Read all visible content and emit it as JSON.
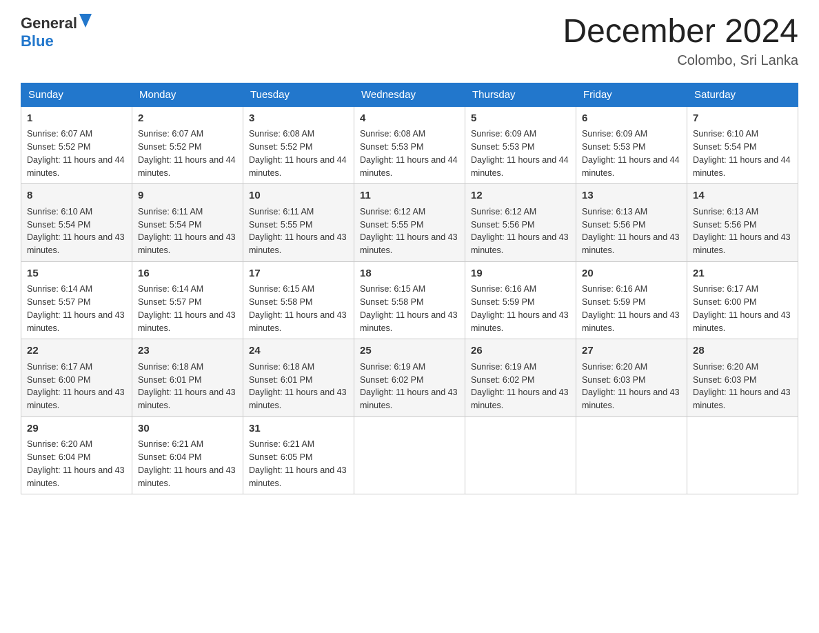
{
  "logo": {
    "text_general": "General",
    "text_blue": "Blue"
  },
  "title": "December 2024",
  "location": "Colombo, Sri Lanka",
  "days_of_week": [
    "Sunday",
    "Monday",
    "Tuesday",
    "Wednesday",
    "Thursday",
    "Friday",
    "Saturday"
  ],
  "weeks": [
    [
      {
        "day": "1",
        "sunrise": "Sunrise: 6:07 AM",
        "sunset": "Sunset: 5:52 PM",
        "daylight": "Daylight: 11 hours and 44 minutes."
      },
      {
        "day": "2",
        "sunrise": "Sunrise: 6:07 AM",
        "sunset": "Sunset: 5:52 PM",
        "daylight": "Daylight: 11 hours and 44 minutes."
      },
      {
        "day": "3",
        "sunrise": "Sunrise: 6:08 AM",
        "sunset": "Sunset: 5:52 PM",
        "daylight": "Daylight: 11 hours and 44 minutes."
      },
      {
        "day": "4",
        "sunrise": "Sunrise: 6:08 AM",
        "sunset": "Sunset: 5:53 PM",
        "daylight": "Daylight: 11 hours and 44 minutes."
      },
      {
        "day": "5",
        "sunrise": "Sunrise: 6:09 AM",
        "sunset": "Sunset: 5:53 PM",
        "daylight": "Daylight: 11 hours and 44 minutes."
      },
      {
        "day": "6",
        "sunrise": "Sunrise: 6:09 AM",
        "sunset": "Sunset: 5:53 PM",
        "daylight": "Daylight: 11 hours and 44 minutes."
      },
      {
        "day": "7",
        "sunrise": "Sunrise: 6:10 AM",
        "sunset": "Sunset: 5:54 PM",
        "daylight": "Daylight: 11 hours and 44 minutes."
      }
    ],
    [
      {
        "day": "8",
        "sunrise": "Sunrise: 6:10 AM",
        "sunset": "Sunset: 5:54 PM",
        "daylight": "Daylight: 11 hours and 43 minutes."
      },
      {
        "day": "9",
        "sunrise": "Sunrise: 6:11 AM",
        "sunset": "Sunset: 5:54 PM",
        "daylight": "Daylight: 11 hours and 43 minutes."
      },
      {
        "day": "10",
        "sunrise": "Sunrise: 6:11 AM",
        "sunset": "Sunset: 5:55 PM",
        "daylight": "Daylight: 11 hours and 43 minutes."
      },
      {
        "day": "11",
        "sunrise": "Sunrise: 6:12 AM",
        "sunset": "Sunset: 5:55 PM",
        "daylight": "Daylight: 11 hours and 43 minutes."
      },
      {
        "day": "12",
        "sunrise": "Sunrise: 6:12 AM",
        "sunset": "Sunset: 5:56 PM",
        "daylight": "Daylight: 11 hours and 43 minutes."
      },
      {
        "day": "13",
        "sunrise": "Sunrise: 6:13 AM",
        "sunset": "Sunset: 5:56 PM",
        "daylight": "Daylight: 11 hours and 43 minutes."
      },
      {
        "day": "14",
        "sunrise": "Sunrise: 6:13 AM",
        "sunset": "Sunset: 5:56 PM",
        "daylight": "Daylight: 11 hours and 43 minutes."
      }
    ],
    [
      {
        "day": "15",
        "sunrise": "Sunrise: 6:14 AM",
        "sunset": "Sunset: 5:57 PM",
        "daylight": "Daylight: 11 hours and 43 minutes."
      },
      {
        "day": "16",
        "sunrise": "Sunrise: 6:14 AM",
        "sunset": "Sunset: 5:57 PM",
        "daylight": "Daylight: 11 hours and 43 minutes."
      },
      {
        "day": "17",
        "sunrise": "Sunrise: 6:15 AM",
        "sunset": "Sunset: 5:58 PM",
        "daylight": "Daylight: 11 hours and 43 minutes."
      },
      {
        "day": "18",
        "sunrise": "Sunrise: 6:15 AM",
        "sunset": "Sunset: 5:58 PM",
        "daylight": "Daylight: 11 hours and 43 minutes."
      },
      {
        "day": "19",
        "sunrise": "Sunrise: 6:16 AM",
        "sunset": "Sunset: 5:59 PM",
        "daylight": "Daylight: 11 hours and 43 minutes."
      },
      {
        "day": "20",
        "sunrise": "Sunrise: 6:16 AM",
        "sunset": "Sunset: 5:59 PM",
        "daylight": "Daylight: 11 hours and 43 minutes."
      },
      {
        "day": "21",
        "sunrise": "Sunrise: 6:17 AM",
        "sunset": "Sunset: 6:00 PM",
        "daylight": "Daylight: 11 hours and 43 minutes."
      }
    ],
    [
      {
        "day": "22",
        "sunrise": "Sunrise: 6:17 AM",
        "sunset": "Sunset: 6:00 PM",
        "daylight": "Daylight: 11 hours and 43 minutes."
      },
      {
        "day": "23",
        "sunrise": "Sunrise: 6:18 AM",
        "sunset": "Sunset: 6:01 PM",
        "daylight": "Daylight: 11 hours and 43 minutes."
      },
      {
        "day": "24",
        "sunrise": "Sunrise: 6:18 AM",
        "sunset": "Sunset: 6:01 PM",
        "daylight": "Daylight: 11 hours and 43 minutes."
      },
      {
        "day": "25",
        "sunrise": "Sunrise: 6:19 AM",
        "sunset": "Sunset: 6:02 PM",
        "daylight": "Daylight: 11 hours and 43 minutes."
      },
      {
        "day": "26",
        "sunrise": "Sunrise: 6:19 AM",
        "sunset": "Sunset: 6:02 PM",
        "daylight": "Daylight: 11 hours and 43 minutes."
      },
      {
        "day": "27",
        "sunrise": "Sunrise: 6:20 AM",
        "sunset": "Sunset: 6:03 PM",
        "daylight": "Daylight: 11 hours and 43 minutes."
      },
      {
        "day": "28",
        "sunrise": "Sunrise: 6:20 AM",
        "sunset": "Sunset: 6:03 PM",
        "daylight": "Daylight: 11 hours and 43 minutes."
      }
    ],
    [
      {
        "day": "29",
        "sunrise": "Sunrise: 6:20 AM",
        "sunset": "Sunset: 6:04 PM",
        "daylight": "Daylight: 11 hours and 43 minutes."
      },
      {
        "day": "30",
        "sunrise": "Sunrise: 6:21 AM",
        "sunset": "Sunset: 6:04 PM",
        "daylight": "Daylight: 11 hours and 43 minutes."
      },
      {
        "day": "31",
        "sunrise": "Sunrise: 6:21 AM",
        "sunset": "Sunset: 6:05 PM",
        "daylight": "Daylight: 11 hours and 43 minutes."
      },
      {
        "day": "",
        "sunrise": "",
        "sunset": "",
        "daylight": ""
      },
      {
        "day": "",
        "sunrise": "",
        "sunset": "",
        "daylight": ""
      },
      {
        "day": "",
        "sunrise": "",
        "sunset": "",
        "daylight": ""
      },
      {
        "day": "",
        "sunrise": "",
        "sunset": "",
        "daylight": ""
      }
    ]
  ]
}
